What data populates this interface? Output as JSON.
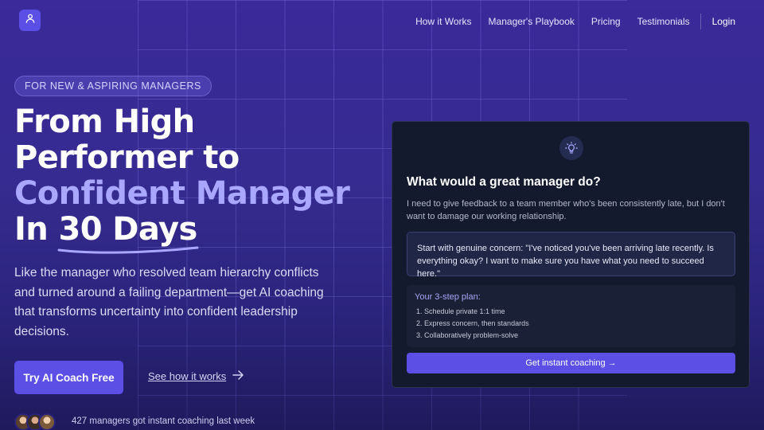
{
  "colors": {
    "accent": "#5b4fe6",
    "headline_accent": "#a9a7ff",
    "card_bg": "#131a2e"
  },
  "nav": {
    "items": [
      "How it Works",
      "Manager's Playbook",
      "Pricing",
      "Testimonials"
    ],
    "login": "Login"
  },
  "hero": {
    "badge": "FOR NEW & ASPIRING MANAGERS",
    "headline_line1": "From High",
    "headline_line2": "Performer to",
    "headline_accent": "Confident Manager",
    "headline_line4_prefix": "In ",
    "headline_line4_underlined": "30 Days",
    "lead": "Like the manager who resolved team hierarchy conflicts and turned around a failing department—get AI coaching that transforms uncertainty into confident leadership decisions.",
    "cta_primary": "Try AI Coach Free",
    "cta_secondary": "See how it works",
    "social_proof": "427 managers got instant coaching last week"
  },
  "icons": {
    "logo": "user-icon",
    "card": "lightbulb-icon",
    "arrow": "arrow-right-icon"
  },
  "card": {
    "title": "What would a great manager do?",
    "prompt": "I need to give feedback to a team member who's been consistently late, but I don't want to damage our working relationship.",
    "reply": "Start with genuine concern: \"I've noticed you've been arriving late recently. Is everything okay? I want to make sure you have what you need to succeed here.\"",
    "plan_title": "Your 3-step plan:",
    "plan_items": [
      "1. Schedule private 1:1 time",
      "2. Express concern, then standards",
      "3. Collaboratively problem-solve"
    ],
    "button": "Get instant coaching →"
  }
}
